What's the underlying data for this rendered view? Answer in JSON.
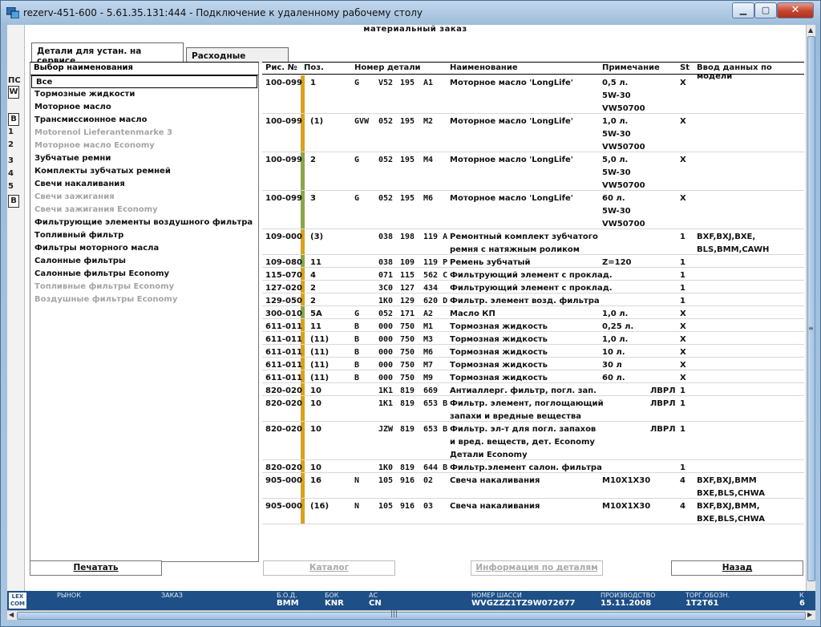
{
  "window": {
    "title": "rezerv-451-600 - 5.61.35.131:444 - Подключение к удаленному рабочему столу",
    "min": "▁",
    "max": "▢",
    "close": "✕"
  },
  "app": {
    "title": "материальный заказ"
  },
  "tabs": [
    "Детали для устан. на сервисе",
    "Расходные детали"
  ],
  "left_edge": [
    "ПС",
    "W",
    "В",
    "1",
    "2",
    "3",
    "4",
    "5",
    "В"
  ],
  "left_pane": {
    "header": "Выбор наименования",
    "items": [
      {
        "label": "Все",
        "state": "selected"
      },
      {
        "label": "Тормозные жидкости",
        "state": "normal"
      },
      {
        "label": "Моторное масло",
        "state": "normal"
      },
      {
        "label": "Трансмиссионное масло",
        "state": "normal"
      },
      {
        "label": "Motorenol Lieferantenmarke 3",
        "state": "disabled"
      },
      {
        "label": "Моторное масло Economy",
        "state": "disabled"
      },
      {
        "label": "Зубчатые ремни",
        "state": "normal"
      },
      {
        "label": "Комплекты зубчатых ремней",
        "state": "normal"
      },
      {
        "label": "Свечи накаливания",
        "state": "normal"
      },
      {
        "label": "Свечи зажигания",
        "state": "disabled"
      },
      {
        "label": "Свечи зажигания Economy",
        "state": "disabled"
      },
      {
        "label": "Фильтрующие элементы воздушного фильтра",
        "state": "normal"
      },
      {
        "label": "Топливный фильтр",
        "state": "normal"
      },
      {
        "label": "Фильтры моторного масла",
        "state": "normal"
      },
      {
        "label": "Салонные фильтры",
        "state": "normal"
      },
      {
        "label": "Салонные фильтры Economy",
        "state": "normal"
      },
      {
        "label": "Топливные фильтры Economy",
        "state": "disabled"
      },
      {
        "label": "Воздушные фильтры Economy",
        "state": "disabled"
      }
    ]
  },
  "table": {
    "headers": {
      "fig": "Рис. №",
      "pos": "Поз.",
      "part": "Номер детали",
      "name": "Наименование",
      "note": "Примечание",
      "st": "St",
      "model": "Ввод данных по модели"
    },
    "rows": [
      {
        "fig": "100-099",
        "pos": "1",
        "bar": "#d9a21b",
        "p1": "G",
        "p2": "V52",
        "p3": "195",
        "p4": "A1",
        "name": [
          "Моторное масло 'LongLife'"
        ],
        "note": [
          "0,5 л.",
          "5W-30",
          "VW50700"
        ],
        "st": "X",
        "model": []
      },
      {
        "fig": "100-099",
        "pos": "(1)",
        "bar": "#d9a21b",
        "p1": "GVW",
        "p2": "052",
        "p3": "195",
        "p4": "M2",
        "name": [
          "Моторное масло 'LongLife'"
        ],
        "note": [
          "1,0 л.",
          "5W-30",
          "VW50700"
        ],
        "st": "X",
        "model": []
      },
      {
        "fig": "100-099",
        "pos": "2",
        "bar": "#8aa64a",
        "p1": "G",
        "p2": "052",
        "p3": "195",
        "p4": "M4",
        "name": [
          "Моторное масло 'LongLife'"
        ],
        "note": [
          "5,0 л.",
          "5W-30",
          "VW50700"
        ],
        "st": "X",
        "model": []
      },
      {
        "fig": "100-099",
        "pos": "3",
        "bar": "#8aa64a",
        "p1": "G",
        "p2": "052",
        "p3": "195",
        "p4": "M6",
        "name": [
          "Моторное масло 'LongLife'"
        ],
        "note": [
          "60 л.",
          "5W-30",
          "VW50700"
        ],
        "st": "X",
        "model": []
      },
      {
        "fig": "109-000",
        "pos": "(3)",
        "bar": "#d9a21b",
        "p1": "",
        "p2": "038",
        "p3": "198",
        "p4": "119 A",
        "name": [
          "Ремонтный комплект зубчатого",
          "ремня с натяжным роликом"
        ],
        "note": [],
        "st": "1",
        "model": [
          "BXF,BXJ,BXE,",
          "BLS,BMM,CAWH"
        ]
      },
      {
        "fig": "109-080",
        "pos": "11",
        "bar": "#8aa64a",
        "p1": "",
        "p2": "038",
        "p3": "109",
        "p4": "119 P",
        "name": [
          "Ремень зубчатый"
        ],
        "note": [
          "Z=120"
        ],
        "st": "1",
        "model": []
      },
      {
        "fig": "115-070",
        "pos": "4",
        "bar": "#d9a21b",
        "p1": "",
        "p2": "071",
        "p3": "115",
        "p4": "562 C",
        "name": [
          "Фильтрующий элемент с проклад."
        ],
        "note": [],
        "st": "1",
        "model": []
      },
      {
        "fig": "127-020",
        "pos": "2",
        "bar": "#d9a21b",
        "p1": "",
        "p2": "3C0",
        "p3": "127",
        "p4": "434",
        "name": [
          "Фильтрующий элемент с проклад."
        ],
        "note": [],
        "st": "1",
        "model": []
      },
      {
        "fig": "129-050",
        "pos": "2",
        "bar": "#d9a21b",
        "p1": "",
        "p2": "1K0",
        "p3": "129",
        "p4": "620 D",
        "name": [
          "Фильтр. элемент возд. фильтра"
        ],
        "note": [],
        "st": "1",
        "model": []
      },
      {
        "fig": "300-010",
        "pos": "5A",
        "bar": "#8aa64a",
        "p1": "G",
        "p2": "052",
        "p3": "171",
        "p4": "A2",
        "name": [
          "Масло КП"
        ],
        "note": [
          "1,0 л."
        ],
        "st": "X",
        "model": []
      },
      {
        "fig": "611-011",
        "pos": "11",
        "bar": "#d9a21b",
        "p1": "B",
        "p2": "000",
        "p3": "750",
        "p4": "M1",
        "name": [
          "Тормозная жидкость"
        ],
        "note": [
          "0,25 л."
        ],
        "st": "X",
        "model": []
      },
      {
        "fig": "611-011",
        "pos": "(11)",
        "bar": "#d9a21b",
        "p1": "B",
        "p2": "000",
        "p3": "750",
        "p4": "M3",
        "name": [
          "Тормозная жидкость"
        ],
        "note": [
          "1,0 л."
        ],
        "st": "X",
        "model": []
      },
      {
        "fig": "611-011",
        "pos": "(11)",
        "bar": "#d9a21b",
        "p1": "B",
        "p2": "000",
        "p3": "750",
        "p4": "M6",
        "name": [
          "Тормозная жидкость"
        ],
        "note": [
          "10 л."
        ],
        "st": "X",
        "model": []
      },
      {
        "fig": "611-011",
        "pos": "(11)",
        "bar": "#d9a21b",
        "p1": "B",
        "p2": "000",
        "p3": "750",
        "p4": "M7",
        "name": [
          "Тормозная жидкость"
        ],
        "note": [
          "30 л"
        ],
        "st": "X",
        "model": []
      },
      {
        "fig": "611-011",
        "pos": "(11)",
        "bar": "#d9a21b",
        "p1": "B",
        "p2": "000",
        "p3": "750",
        "p4": "M9",
        "name": [
          "Тормозная жидкость"
        ],
        "note": [
          "60 л."
        ],
        "st": "X",
        "model": []
      },
      {
        "fig": "820-020",
        "pos": "10",
        "bar": "#d9a21b",
        "p1": "",
        "p2": "1K1",
        "p3": "819",
        "p4": "669",
        "name": [
          "Антиаллерг. фильтр, погл. зап."
        ],
        "note": [
          "ЛВРЛ"
        ],
        "st": "1",
        "model": []
      },
      {
        "fig": "820-020",
        "pos": "10",
        "bar": "#d9a21b",
        "p1": "",
        "p2": "1K1",
        "p3": "819",
        "p4": "653 B",
        "name": [
          "Фильтр. элемент, поглощающий",
          "запахи и вредные вещества"
        ],
        "note": [
          "ЛВРЛ"
        ],
        "st": "1",
        "model": []
      },
      {
        "fig": "820-020",
        "pos": "10",
        "bar": "#d9a21b",
        "p1": "",
        "p2": "JZW",
        "p3": "819",
        "p4": "653 B",
        "name": [
          "Фильтр. эл-т для погл. запахов",
          "и вред. веществ, дет. Economy",
          "Детали Economy"
        ],
        "note": [
          "ЛВРЛ"
        ],
        "st": "1",
        "model": []
      },
      {
        "fig": "820-020",
        "pos": "10",
        "bar": "#d9a21b",
        "p1": "",
        "p2": "1K0",
        "p3": "819",
        "p4": "644 B",
        "name": [
          "Фильтр.элемент салон. фильтра"
        ],
        "note": [],
        "st": "1",
        "model": []
      },
      {
        "fig": "905-000",
        "pos": "16",
        "bar": "#d9a21b",
        "p1": "N",
        "p2": "105",
        "p3": "916",
        "p4": "02",
        "name": [
          "Свеча накаливания"
        ],
        "note": [
          "M10X1X30"
        ],
        "st": "4",
        "model": [
          "BXF,BXJ,BMM",
          "BXE,BLS,CHWA"
        ]
      },
      {
        "fig": "905-000",
        "pos": "(16)",
        "bar": "#d9a21b",
        "p1": "N",
        "p2": "105",
        "p3": "916",
        "p4": "03",
        "name": [
          "Свеча накаливания"
        ],
        "note": [
          "M10X1X30"
        ],
        "st": "4",
        "model": [
          "BXF,BXJ,BMM,",
          "BXE,BLS,CHWA"
        ]
      }
    ]
  },
  "buttons": {
    "print": "Печатать",
    "catalog": "Каталог",
    "info": "Информация по деталям",
    "back": "Назад"
  },
  "status": {
    "logo": "LEX\nCON",
    "market_label": "РЫНОК",
    "order_label": "ЗАКАЗ",
    "bod_label": "Б.О.Д.",
    "bod": "BMM",
    "bok_label": "БОК",
    "bok": "KNR",
    "ac_label": "АС",
    "ac": "CN",
    "vin_label": "НОМЕР ШАССИ",
    "vin": "WVGZZZ1TZ9W072677",
    "prod_label": "ПРОИЗВОДСТВО",
    "prod": "15.11.2008",
    "trade_label": "ТОРГ.ОБОЗН.",
    "trade": "1T2T61",
    "extra_label": "К",
    "extra": "6"
  }
}
